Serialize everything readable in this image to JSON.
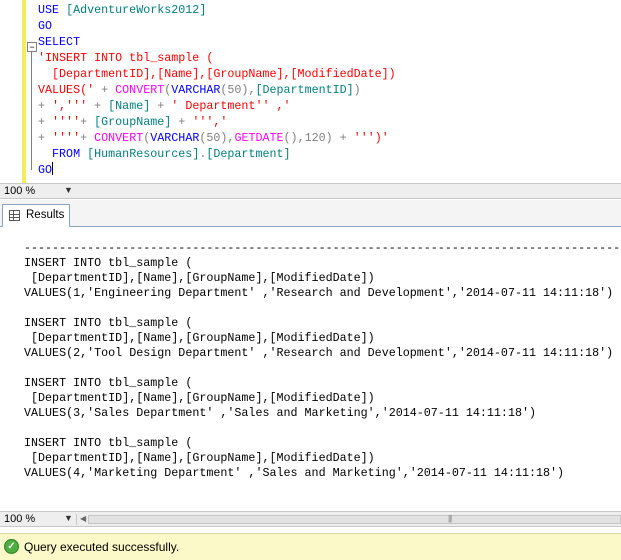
{
  "editor": {
    "zoom": "100 %",
    "lines": [
      [
        [
          "kw",
          "USE "
        ],
        [
          "tx",
          "[AdventureWorks2012]"
        ]
      ],
      [
        [
          "kw",
          "GO"
        ]
      ],
      [
        [
          "kw",
          "SELECT"
        ]
      ],
      [
        [
          "str",
          "'INSERT INTO tbl_sample ("
        ]
      ],
      [
        [
          "str",
          "  [DepartmentID],[Name],[GroupName],[ModifiedDate])"
        ]
      ],
      [
        [
          "str",
          "VALUES('"
        ],
        [
          "gr",
          " + "
        ],
        [
          "fn",
          "CONVERT"
        ],
        [
          "gr",
          "("
        ],
        [
          "kw",
          "VARCHAR"
        ],
        [
          "gr",
          "(50),"
        ],
        [
          "tx",
          "[DepartmentID]"
        ],
        [
          "gr",
          ")"
        ]
      ],
      [
        [
          "gr",
          "+ "
        ],
        [
          "str",
          "','''"
        ],
        [
          "gr",
          " + "
        ],
        [
          "tx",
          "[Name]"
        ],
        [
          "gr",
          " + "
        ],
        [
          "str",
          "' Department'' ,'"
        ]
      ],
      [
        [
          "gr",
          "+ "
        ],
        [
          "str",
          "''''"
        ],
        [
          "gr",
          "+ "
        ],
        [
          "tx",
          "[GroupName]"
        ],
        [
          "gr",
          " + "
        ],
        [
          "str",
          "''','"
        ]
      ],
      [
        [
          "gr",
          "+ "
        ],
        [
          "str",
          "''''"
        ],
        [
          "gr",
          "+ "
        ],
        [
          "fn",
          "CONVERT"
        ],
        [
          "gr",
          "("
        ],
        [
          "kw",
          "VARCHAR"
        ],
        [
          "gr",
          "(50),"
        ],
        [
          "fn",
          "GETDATE"
        ],
        [
          "gr",
          "(),120) + "
        ],
        [
          "str",
          "''')'"
        ]
      ],
      [
        [
          "kw",
          "  FROM "
        ],
        [
          "tx",
          "[HumanResources]"
        ],
        [
          "gr",
          "."
        ],
        [
          "tx",
          "[Department]"
        ]
      ],
      [
        [
          "kw",
          "GO"
        ]
      ]
    ]
  },
  "results_tab": {
    "label": "Results"
  },
  "results": {
    "separator": "---------------------------------------------------------------------------------------------------------------------------------------------",
    "rows": [
      [
        "INSERT INTO tbl_sample (",
        " [DepartmentID],[Name],[GroupName],[ModifiedDate])",
        "VALUES(1,'Engineering Department' ,'Research and Development','2014-07-11 14:11:18')"
      ],
      [
        "INSERT INTO tbl_sample (",
        " [DepartmentID],[Name],[GroupName],[ModifiedDate])",
        "VALUES(2,'Tool Design Department' ,'Research and Development','2014-07-11 14:11:18')"
      ],
      [
        "INSERT INTO tbl_sample (",
        " [DepartmentID],[Name],[GroupName],[ModifiedDate])",
        "VALUES(3,'Sales Department' ,'Sales and Marketing','2014-07-11 14:11:18')"
      ],
      [
        "INSERT INTO tbl_sample (",
        " [DepartmentID],[Name],[GroupName],[ModifiedDate])",
        "VALUES(4,'Marketing Department' ,'Sales and Marketing','2014-07-11 14:11:18')"
      ]
    ]
  },
  "results_zoom": "100 %",
  "status": {
    "text": "Query executed successfully.",
    "color": "#fcf9c8"
  }
}
